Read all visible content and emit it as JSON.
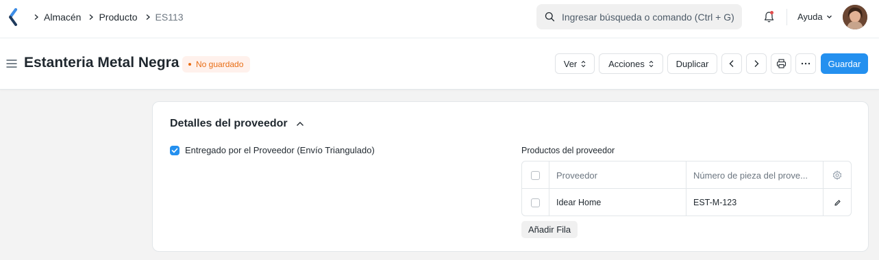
{
  "breadcrumb": {
    "items": [
      "Almacén",
      "Producto"
    ],
    "current": "ES113"
  },
  "search": {
    "placeholder": "Ingresar búsqueda o comando (Ctrl + G)"
  },
  "navbar": {
    "help_label": "Ayuda"
  },
  "page": {
    "title": "Estanteria Metal Negra",
    "status": "No guardado"
  },
  "toolbar": {
    "view_label": "Ver",
    "actions_label": "Acciones",
    "duplicate_label": "Duplicar",
    "save_label": "Guardar"
  },
  "section": {
    "title": "Detalles del proveedor",
    "drop_ship_label": "Entregado por el Proveedor (Envío Triangulado)",
    "drop_ship_checked": true
  },
  "supplier_grid": {
    "label": "Productos del proveedor",
    "columns": [
      "Proveedor",
      "Número de pieza del prove..."
    ],
    "rows": [
      {
        "supplier": "Idear Home",
        "part_no": "EST-M-123"
      }
    ],
    "add_row_label": "Añadir Fila"
  },
  "colors": {
    "primary": "#2490ef",
    "status_text": "#e86c13",
    "status_bg": "#fff1ec",
    "page_bg": "#f3f3f3"
  }
}
